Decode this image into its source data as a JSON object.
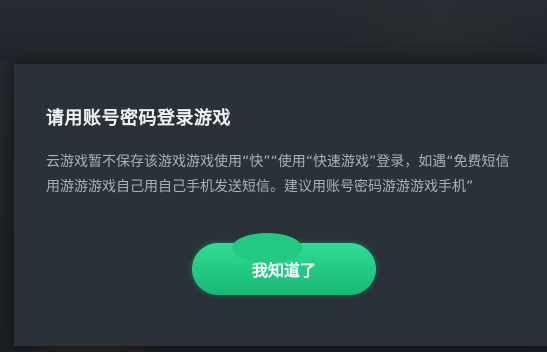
{
  "dialog": {
    "title": "请用账号密码登录游戏",
    "message": "云游戏暂不保存该游戏游戏使用“快”“使用“快速游戏”登录，如遇“免费短信用游游游戏自己用自己手机发送短信。建议用账号密码游游游戏手机”",
    "confirm_label": "我知道了"
  },
  "colors": {
    "accent": "#1fc47f",
    "dialog_background": "#2b3138",
    "title_text": "#f1f3f5",
    "body_text": "#a9b0b8"
  }
}
